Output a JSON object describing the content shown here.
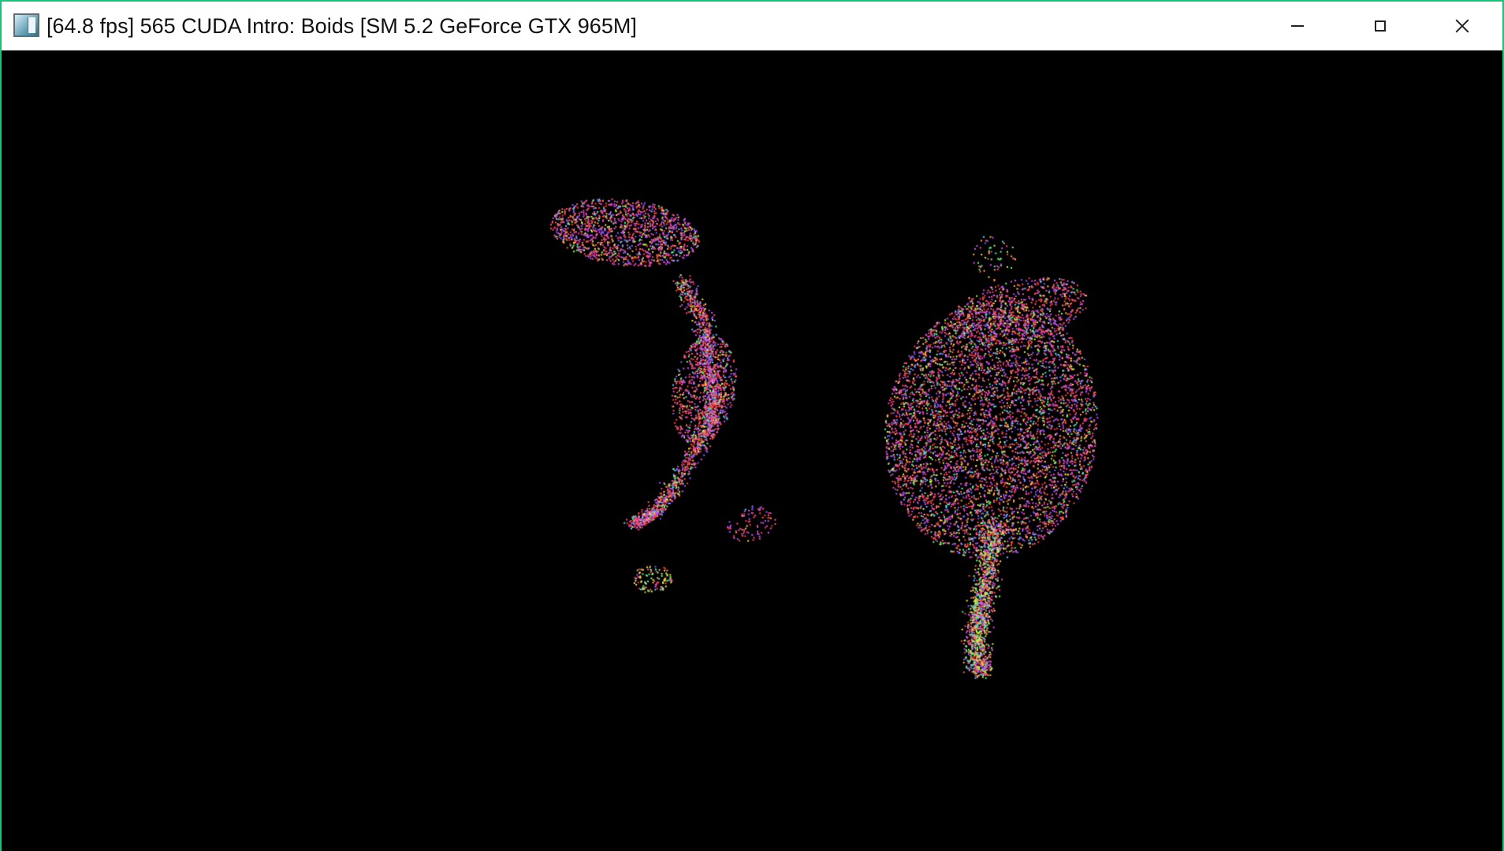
{
  "window": {
    "title": "[64.8 fps] 565 CUDA Intro: Boids [SM 5.2 GeForce GTX 965M]",
    "border_color": "#19c47a"
  },
  "titlebar": {
    "icon": "app-window-icon",
    "buttons": [
      {
        "name": "minimize",
        "icon": "minimize-icon"
      },
      {
        "name": "maximize",
        "icon": "maximize-icon"
      },
      {
        "name": "close",
        "icon": "close-icon"
      }
    ]
  },
  "viewport": {
    "background": "#000000",
    "content": "boids-particle-simulation",
    "palette": [
      "#ff3b3b",
      "#ff5a5a",
      "#ff4f8a",
      "#d94cff",
      "#8a5cff",
      "#ffb347",
      "#ffe04d",
      "#b6ff4d",
      "#5cff8a",
      "#4dd2ff"
    ]
  }
}
